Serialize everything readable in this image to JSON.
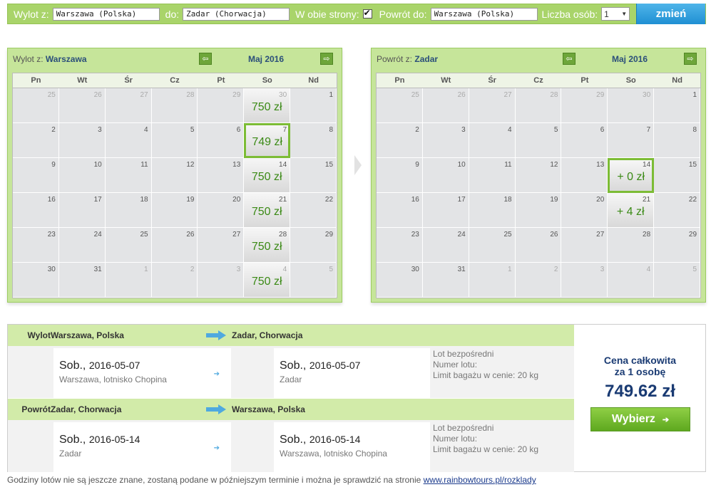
{
  "search": {
    "from_label": "Wylot z:",
    "from_value": "Warszawa (Polska)",
    "to_label": "do:",
    "to_value": "Zadar (Chorwacja)",
    "roundtrip_label": "W obie strony:",
    "roundtrip_checked": true,
    "return_label": "Powrót do:",
    "return_value": "Warszawa (Polska)",
    "persons_label": "Liczba osób:",
    "persons_value": "1",
    "change_button": "zmień"
  },
  "dow": [
    "Pn",
    "Wt",
    "Śr",
    "Cz",
    "Pt",
    "So",
    "Nd"
  ],
  "outbound_calendar": {
    "title_prefix": "Wylot z:",
    "title_city": "Warszawa",
    "month": "Maj 2016",
    "weeks": [
      [
        {
          "d": "25",
          "o": 1
        },
        {
          "d": "26",
          "o": 1
        },
        {
          "d": "27",
          "o": 1
        },
        {
          "d": "28",
          "o": 1
        },
        {
          "d": "29",
          "o": 1
        },
        {
          "d": "30",
          "o": 1,
          "p": "750 zł"
        },
        {
          "d": "1"
        }
      ],
      [
        {
          "d": "2"
        },
        {
          "d": "3"
        },
        {
          "d": "4"
        },
        {
          "d": "5"
        },
        {
          "d": "6"
        },
        {
          "d": "7",
          "p": "749 zł",
          "s": 1
        },
        {
          "d": "8"
        }
      ],
      [
        {
          "d": "9"
        },
        {
          "d": "10"
        },
        {
          "d": "11"
        },
        {
          "d": "12"
        },
        {
          "d": "13"
        },
        {
          "d": "14",
          "p": "750 zł"
        },
        {
          "d": "15"
        }
      ],
      [
        {
          "d": "16"
        },
        {
          "d": "17"
        },
        {
          "d": "18"
        },
        {
          "d": "19"
        },
        {
          "d": "20"
        },
        {
          "d": "21",
          "p": "750 zł"
        },
        {
          "d": "22"
        }
      ],
      [
        {
          "d": "23"
        },
        {
          "d": "24"
        },
        {
          "d": "25"
        },
        {
          "d": "26"
        },
        {
          "d": "27"
        },
        {
          "d": "28",
          "p": "750 zł"
        },
        {
          "d": "29"
        }
      ],
      [
        {
          "d": "30"
        },
        {
          "d": "31"
        },
        {
          "d": "1",
          "o": 1
        },
        {
          "d": "2",
          "o": 1
        },
        {
          "d": "3",
          "o": 1
        },
        {
          "d": "4",
          "o": 1,
          "p": "750 zł"
        },
        {
          "d": "5",
          "o": 1
        }
      ]
    ]
  },
  "return_calendar": {
    "title_prefix": "Powrót z:",
    "title_city": "Zadar",
    "month": "Maj 2016",
    "weeks": [
      [
        {
          "d": "25",
          "o": 1
        },
        {
          "d": "26",
          "o": 1
        },
        {
          "d": "27",
          "o": 1
        },
        {
          "d": "28",
          "o": 1
        },
        {
          "d": "29",
          "o": 1
        },
        {
          "d": "30",
          "o": 1
        },
        {
          "d": "1"
        }
      ],
      [
        {
          "d": "2"
        },
        {
          "d": "3"
        },
        {
          "d": "4"
        },
        {
          "d": "5"
        },
        {
          "d": "6"
        },
        {
          "d": "7"
        },
        {
          "d": "8"
        }
      ],
      [
        {
          "d": "9"
        },
        {
          "d": "10"
        },
        {
          "d": "11"
        },
        {
          "d": "12"
        },
        {
          "d": "13"
        },
        {
          "d": "14",
          "p": "+ 0 zł",
          "s": 1
        },
        {
          "d": "15"
        }
      ],
      [
        {
          "d": "16"
        },
        {
          "d": "17"
        },
        {
          "d": "18"
        },
        {
          "d": "19"
        },
        {
          "d": "20"
        },
        {
          "d": "21",
          "p": "+ 4 zł"
        },
        {
          "d": "22"
        }
      ],
      [
        {
          "d": "23"
        },
        {
          "d": "24"
        },
        {
          "d": "25"
        },
        {
          "d": "26"
        },
        {
          "d": "27"
        },
        {
          "d": "28"
        },
        {
          "d": "29"
        }
      ],
      [
        {
          "d": "30"
        },
        {
          "d": "31"
        },
        {
          "d": "1",
          "o": 1
        },
        {
          "d": "2",
          "o": 1
        },
        {
          "d": "3",
          "o": 1
        },
        {
          "d": "4",
          "o": 1
        },
        {
          "d": "5",
          "o": 1
        }
      ]
    ]
  },
  "outbound": {
    "label": "Wylot",
    "from": "Warszawa, Polska",
    "to": "Zadar, Chorwacja",
    "dep_day": "Sob.,",
    "dep_date": "2016-05-07",
    "dep_place": "Warszawa, lotnisko Chopina",
    "arr_day": "Sob.,",
    "arr_date": "2016-05-07",
    "arr_place": "Zadar",
    "info1": "Lot bezpośredni",
    "info2": "Numer lotu:",
    "info3": "Limit bagażu w cenie: 20 kg"
  },
  "inbound": {
    "label": "Powrót",
    "from": "Zadar, Chorwacja",
    "to": "Warszawa, Polska",
    "dep_day": "Sob.,",
    "dep_date": "2016-05-14",
    "dep_place": "Zadar",
    "arr_day": "Sob.,",
    "arr_date": "2016-05-14",
    "arr_place": "Warszawa, lotnisko Chopina",
    "info1": "Lot bezpośredni",
    "info2": "Numer lotu:",
    "info3": "Limit bagażu w cenie: 20 kg"
  },
  "price": {
    "title_line1": "Cena całkowita",
    "title_line2": "za 1 osobę",
    "value": "749.62 zł",
    "button": "Wybierz"
  },
  "footnote": {
    "text": "Godziny lotów nie są jeszcze znane, zostaną podane w późniejszym terminie i można je sprawdzić na stronie ",
    "link": "www.rainbowtours.pl/rozklady"
  }
}
